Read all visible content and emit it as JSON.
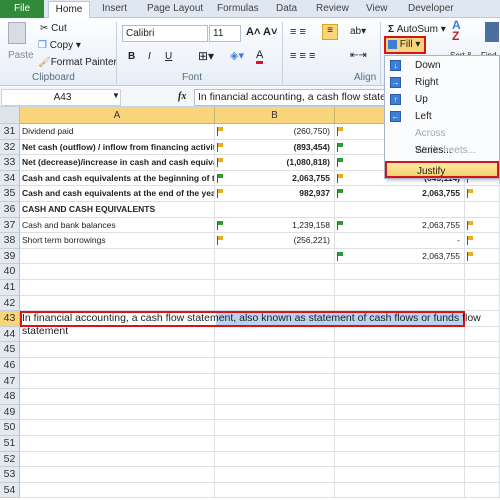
{
  "tabs": [
    "File",
    "Home",
    "Insert",
    "Page Layout",
    "Formulas",
    "Data",
    "Review",
    "View",
    "Developer"
  ],
  "clipboard": {
    "paste": "Paste",
    "cut": "Cut",
    "copy": "Copy",
    "format_painter": "Format Painter",
    "group": "Clipboard"
  },
  "font": {
    "name": "Calibri",
    "size": "11",
    "bold": "B",
    "italic": "I",
    "underline": "U",
    "group": "Font"
  },
  "alignment": {
    "group": "Align"
  },
  "editing": {
    "autosum": "AutoSum",
    "fill": "Fill",
    "sort": "Sort &",
    "find": "Find"
  },
  "formula_bar": {
    "name_box": "A43",
    "fx": "fx",
    "content": "In financial accounting, a cash flow statement, also known as statement of cash flows or funds flow statement"
  },
  "columns": [
    "A",
    "B",
    "C",
    ""
  ],
  "rows": [
    {
      "n": "31",
      "a": "Dividend paid",
      "b": "(260,750)",
      "c": "",
      "d": "",
      "bold": false,
      "fa": "y",
      "fb": "y",
      "fc": "",
      "fd": ""
    },
    {
      "n": "32",
      "a": "Net cash (outflow) / inflow from financing activities",
      "b": "(893,454)",
      "c": "",
      "d": "",
      "bold": true,
      "fa": "y",
      "fb": "g",
      "fc": "",
      "fd": ""
    },
    {
      "n": "33",
      "a": "Net (decrease)/increase in cash and cash equivalents",
      "b": "(1,080,818)",
      "c": "",
      "d": "",
      "bold": true,
      "fa": "y",
      "fb": "g",
      "fc": "",
      "fd": ""
    },
    {
      "n": "34",
      "a": "Cash and cash equivalents at the beginning of the year",
      "b": "2,063,755",
      "c": "(645,114)",
      "d": "",
      "bold": true,
      "fa": "g",
      "fb": "y",
      "fc": "y",
      "fd": ""
    },
    {
      "n": "35",
      "a": "Cash and cash equivalents at the end of the year",
      "b": "982,937",
      "c": "2,063,755",
      "d": "",
      "bold": true,
      "fa": "y",
      "fb": "g",
      "fc": "y",
      "fd": ""
    },
    {
      "n": "36",
      "a": "CASH AND CASH EQUIVALENTS",
      "b": "",
      "c": "",
      "d": "",
      "bold": true,
      "fa": "",
      "fb": "",
      "fc": "",
      "fd": ""
    },
    {
      "n": "37",
      "a": "Cash and bank balances",
      "b": "1,239,158",
      "c": "2,063,755",
      "d": "",
      "bold": false,
      "fa": "g",
      "fb": "g",
      "fc": "y",
      "fd": ""
    },
    {
      "n": "38",
      "a": "Short term borrowings",
      "b": "(256,221)",
      "c": "-",
      "d": "",
      "bold": false,
      "fa": "y",
      "fb": "",
      "fc": "y",
      "fd": ""
    },
    {
      "n": "39",
      "a": "",
      "b": "",
      "c": "2,063,755",
      "d": "",
      "bold": false,
      "fa": "",
      "fb": "g",
      "fc": "y",
      "fd": ""
    },
    {
      "n": "40"
    },
    {
      "n": "41"
    },
    {
      "n": "42"
    },
    {
      "n": "43",
      "a": "In financial accounting, a cash flow statement, also known as statement of cash flows or funds flow statement",
      "selected": true
    },
    {
      "n": "44"
    },
    {
      "n": "45"
    },
    {
      "n": "46"
    },
    {
      "n": "47"
    },
    {
      "n": "48"
    },
    {
      "n": "49"
    },
    {
      "n": "50"
    },
    {
      "n": "51"
    },
    {
      "n": "52"
    },
    {
      "n": "53"
    },
    {
      "n": "54"
    }
  ],
  "fill_menu": [
    {
      "label": "Down",
      "icon": "arrow-down-icon",
      "enabled": true
    },
    {
      "label": "Right",
      "icon": "arrow-right-icon",
      "enabled": true
    },
    {
      "label": "Up",
      "icon": "arrow-up-icon",
      "enabled": true
    },
    {
      "label": "Left",
      "icon": "arrow-left-icon",
      "enabled": true
    },
    {
      "label": "Across Worksheets...",
      "enabled": false
    },
    {
      "label": "Series...",
      "enabled": true
    },
    {
      "label": "Justify",
      "enabled": true,
      "highlighted": true
    }
  ],
  "colors": {
    "file_tab": "#2f8a3a",
    "highlight_box": "#d8141b",
    "selection": "#b9d3f0",
    "header_selected": "#f8d57a"
  }
}
